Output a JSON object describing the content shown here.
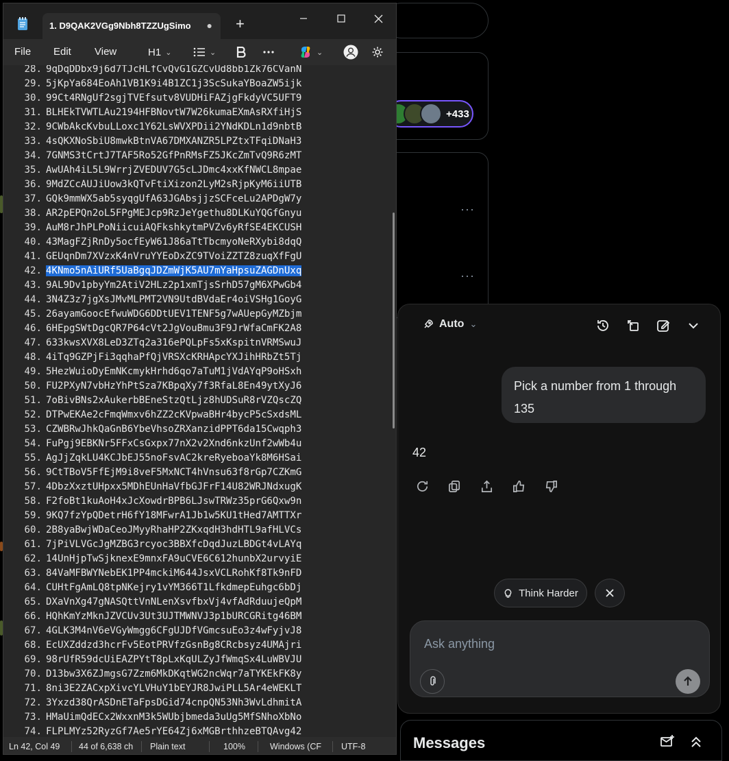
{
  "notepad": {
    "tab_title": "1. D9QAK2VGg9Nbh8TZZUgSimo",
    "tab_modified": "●",
    "new_tab": "+",
    "menu": {
      "file": "File",
      "edit": "Edit",
      "view": "View"
    },
    "toolbar": {
      "heading": "H1"
    },
    "lines": [
      {
        "n": "28.",
        "t": "9qDqDDbx9j6d7TJcHLfCvQvG1GZCvUd8bb1Zk76CVanN"
      },
      {
        "n": "29.",
        "t": "5jKpYa684EoAh1VB1K9i4B1ZC1j3ScSukaYBoaZW5ijk"
      },
      {
        "n": "30.",
        "t": "99Ct4RNgUf2sgjTVEfsutv8VUDHiFAZjgFkdyVC5UFT9"
      },
      {
        "n": "31.",
        "t": "BLHEkTVWTLAu2194HFBNovtW7W26kumaEXmAsRXfiHjS"
      },
      {
        "n": "32.",
        "t": "9CWbAkcKvbuLLoxc1Y62LsWVXPDii2YNdKDLn1d9nbtB"
      },
      {
        "n": "33.",
        "t": "4sQKXNoSbiU8mwkBtnVA67DMXANZR5LPZtxTFqiDNaH3"
      },
      {
        "n": "34.",
        "t": "7GNMS3tCrtJ7TAF5Ro52GfPnRMsFZ5JKcZmTvQ9R6zMT"
      },
      {
        "n": "35.",
        "t": "AwUAh4iL5L9WrrjZVEDUV7G5cLJDmc4xxKfNWCL8mpae"
      },
      {
        "n": "36.",
        "t": "9MdZCcAUJiUow3kQTvFtiXizon2LyM2sRjpKyM6iiUTB"
      },
      {
        "n": "37.",
        "t": "GQk9mmWX5ab5syqgUfA63JGAbsjjzSCFceLu2APDgW7y"
      },
      {
        "n": "38.",
        "t": "AR2pEPQn2oL5FPgMEJcp9RzJeYgethu8DLKuYQGfGnyu"
      },
      {
        "n": "39.",
        "t": "AuM8rJhPLPoNiicuiAQFkshkytmPVZv6yRfSE4EKCUSH"
      },
      {
        "n": "40.",
        "t": "43MagFZjRnDy5ocfEyW61J86aTtTbcmyoNeRXybi8dqQ"
      },
      {
        "n": "41.",
        "t": "GEUqnDm7XVzxK4nVruYYEoDxZC9TVoiZZTZ8zuqXfFgU"
      },
      {
        "n": "42.",
        "t": "4KNmo5nAiURf5UaBgqJDZmWjK5AU7mYaHpsuZAGDnUxq",
        "sel": true
      },
      {
        "n": "43.",
        "t": "9AL9Dv1pbyYm2AtiV2HLz2p1xmTjsSrhD57gM6XPwGb4"
      },
      {
        "n": "44.",
        "t": "3N4Z3z7jgXsJMvMLPMT2VN9UtdBVdaEr4oiVSHg1GoyG"
      },
      {
        "n": "45.",
        "t": "26ayamGoocEfwuWDG6DDtUEV1TENF5g7wAUepGyMZbjm"
      },
      {
        "n": "46.",
        "t": "6HEpgSWtDgcQR7P64cVt2JgVouBmu3F9JrWfaCmFK2A8"
      },
      {
        "n": "47.",
        "t": "633kwsXVX8LeD3ZTq2a316ePQLpFs5xKspitnVRMSwuJ"
      },
      {
        "n": "48.",
        "t": "4iTq9GZPjFi3qqhaPfQjVRSXcKRHApcYXJihHRbZt5Tj"
      },
      {
        "n": "49.",
        "t": "5HezWuioDyEmNKcmykHrhd6qo7aTuM1jVdAYqP9oHSxh"
      },
      {
        "n": "50.",
        "t": "FU2PXyN7vbHzYhPtSza7KBpqXy7f3RfaL8En49ytXyJ6"
      },
      {
        "n": "51.",
        "t": "7oBivBNs2xAukerbBEneStzQtLjz8hUDSuR8rVZQscZQ"
      },
      {
        "n": "52.",
        "t": "DTPwEKAe2cFmqWmxv6hZZ2cKVpwaBHr4bycP5cSxdsML"
      },
      {
        "n": "53.",
        "t": "CZWBRwJhkQaGnB6YbeVhsoZRXanzidPPT6da15Cwqph3"
      },
      {
        "n": "54.",
        "t": "FuPgj9EBKNr5FFxCsGxpx77nX2v2Xnd6nkzUnf2wWb4u"
      },
      {
        "n": "55.",
        "t": "AgJjZqkLU4KCJbEJ55noFsvAC2kreRyeboaYk8M6HSai"
      },
      {
        "n": "56.",
        "t": "9CtTBoV5FfEjM9i8veF5MxNCT4hVnsu63f8rGp7CZKmG"
      },
      {
        "n": "57.",
        "t": "4DbzXxztUHpxx5MDhEUnHaVfbGJFrF14U82WRJNdxugK"
      },
      {
        "n": "58.",
        "t": "F2foBt1kuAoH4xJcXowdrBPB6LJswTRWz35prG6Qxw9n"
      },
      {
        "n": "59.",
        "t": "9KQ7fzYpQDetrH6fY18MFwrA1Jb1w5KU1tHed7AMTTXr"
      },
      {
        "n": "60.",
        "t": "2B8yaBwjWDaCeoJMyyRhaHP2ZKxqdH3hdHTL9afHLVCs"
      },
      {
        "n": "61.",
        "t": "7jPiVLVGcJgMZBG3rcyoc3BBXfcDqdJuzLBDGt4vLAYq"
      },
      {
        "n": "62.",
        "t": "14UnHjpTwSjknexE9mnxFA9uCVE6C612hunbX2urvyiE"
      },
      {
        "n": "63.",
        "t": "84VaMFBWYNebEK1PP4mckiM644JsxVCLRohKf8Tk9nFD"
      },
      {
        "n": "64.",
        "t": "CUHtFgAmLQ8tpNKejry1vYM366T1LfkdmepEuhgc6bDj"
      },
      {
        "n": "65.",
        "t": "DXaVnXg47gNASQttVnNLenXsvfbxVj4vfAdRduujeQpM"
      },
      {
        "n": "66.",
        "t": "HQhKmYzMknJZVCUv3Ut3UJTMWNVJ3p1bURCGRitg46BM"
      },
      {
        "n": "67.",
        "t": "4GLK3M4nV6eVGyWmgg6CFgUJDfVGmcsuEo3z4wFyjvJ8"
      },
      {
        "n": "68.",
        "t": "EcUXZddzd3hcrFv5EotPRVfzGsnBg8CRcbsyz4UMAjri"
      },
      {
        "n": "69.",
        "t": "98rUfR59dcUiEAZPYtT8pLxKqULZyJfWmqSx4LuWBVJU"
      },
      {
        "n": "70.",
        "t": "D13bw3X6ZJmgsG7Zzm6MkDKqtWG2ncWqr7aTYKEkFK8y"
      },
      {
        "n": "71.",
        "t": "8ni3E2ZACxpXivcYLVHuY1bEYJR8JwiPLL5Ar4eWEKLT"
      },
      {
        "n": "72.",
        "t": "3Yxzd38QrASDnETaFpsDGid74cnpQN53Nh3WvLdhmitA"
      },
      {
        "n": "73.",
        "t": "HMaUimQdECx2WxxnM3k5WUbjbmeda3uUg5MfSNhoXbNo"
      },
      {
        "n": "74.",
        "t": "FLPLMYz52RyzGf7Ae5rYE64Zj6xMGBrthhzeBTQAvg42"
      }
    ],
    "status": {
      "position": "Ln 42, Col 49",
      "chars": "44 of 6,638 ch",
      "format": "Plain text",
      "zoom": "100%",
      "eol": "Windows (CF",
      "encoding": "UTF-8"
    }
  },
  "background": {
    "followers_count": "+433"
  },
  "grok": {
    "model": "Auto",
    "user_message": "Pick a number from 1 through 135",
    "response": "42",
    "think_harder": "Think Harder",
    "input_placeholder": "Ask anything"
  },
  "messages": {
    "title": "Messages"
  },
  "colors": {
    "selection": "#1e6bd6",
    "accent_ring": "#7856ff",
    "panel_bg": "#121212"
  }
}
